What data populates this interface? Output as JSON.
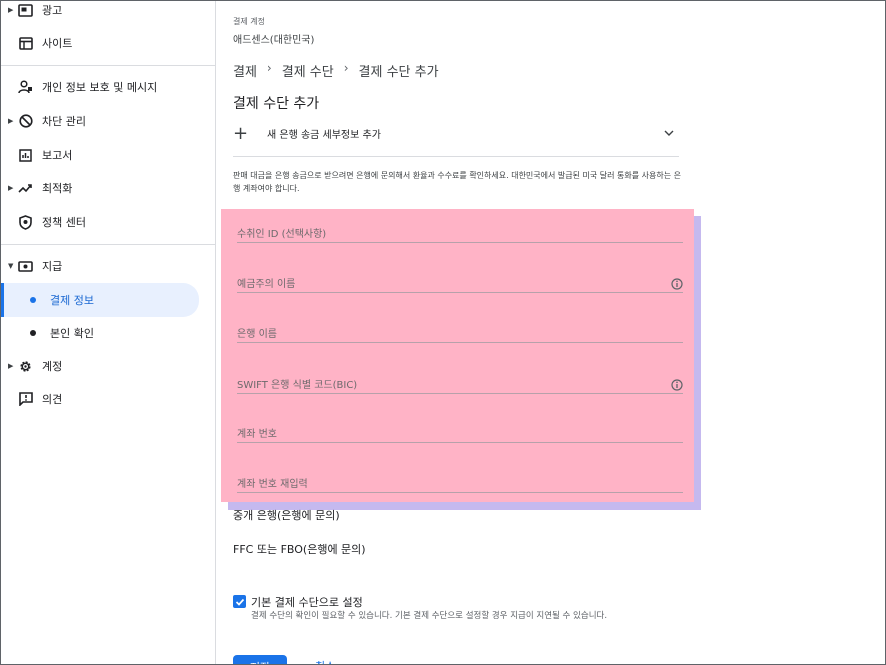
{
  "sidebar": {
    "items": [
      {
        "label": "광고",
        "icon": "ads-icon",
        "caret": true
      },
      {
        "label": "사이트",
        "icon": "sites-icon",
        "caret": false
      },
      {
        "label": "개인 정보 보호 및 메시지",
        "icon": "privacy-icon",
        "caret": false
      },
      {
        "label": "차단 관리",
        "icon": "block-icon",
        "caret": true
      },
      {
        "label": "보고서",
        "icon": "reports-icon",
        "caret": false
      },
      {
        "label": "최적화",
        "icon": "optimization-icon",
        "caret": true
      },
      {
        "label": "정책 센터",
        "icon": "policy-icon",
        "caret": false
      },
      {
        "label": "지급",
        "icon": "payments-icon",
        "caret": true,
        "expanded": true
      },
      {
        "label": "계정",
        "icon": "gear-icon",
        "caret": true
      },
      {
        "label": "의견",
        "icon": "feedback-icon",
        "caret": false
      }
    ],
    "sub_items": [
      {
        "label": "결제 정보",
        "active": true
      },
      {
        "label": "본인 확인",
        "active": false
      }
    ]
  },
  "account": {
    "label": "결제 계정",
    "name": "애드센스(대한민국)"
  },
  "breadcrumb": [
    "결제",
    "결제 수단",
    "결제 수단 추가"
  ],
  "page_title": "결제 수단 추가",
  "add_bank": {
    "label": "새 은행 송금 세부정보 추가"
  },
  "description": "판매 대금을 은행 송금으로 받으려면 은행에 문의해서 환율과 수수료를 확인하세요. 대한민국에서 발급된 미국 달러 통화를 사용하는 은행 계좌여야 합니다.",
  "fields": [
    {
      "placeholder": "수취인 ID (선택사항)",
      "info": false
    },
    {
      "placeholder": "예금주의 이름",
      "info": true
    },
    {
      "placeholder": "은행 이름",
      "info": false
    },
    {
      "placeholder": "SWIFT 은행 식별 코드(BIC)",
      "info": true
    },
    {
      "placeholder": "계좌 번호",
      "info": false
    },
    {
      "placeholder": "계좌 번호 재입력",
      "info": false
    }
  ],
  "extra_fields": [
    "중개 은행(은행에 문의)",
    "FFC 또는 FBO(은행에 문의)"
  ],
  "default_checkbox": {
    "checked": true,
    "label": "기본 결제 수단으로 설정",
    "sub": "결제 수단의 확인이 필요할 수 있습니다. 기본 결제 수단으로 설정할 경우 지급이 지연될 수 있습니다."
  },
  "buttons": {
    "save": "저장",
    "cancel": "취소"
  },
  "colors": {
    "accent": "#1a73e8",
    "overlay": "#ffb3c6",
    "overlay_shadow": "#c5b9ef"
  }
}
